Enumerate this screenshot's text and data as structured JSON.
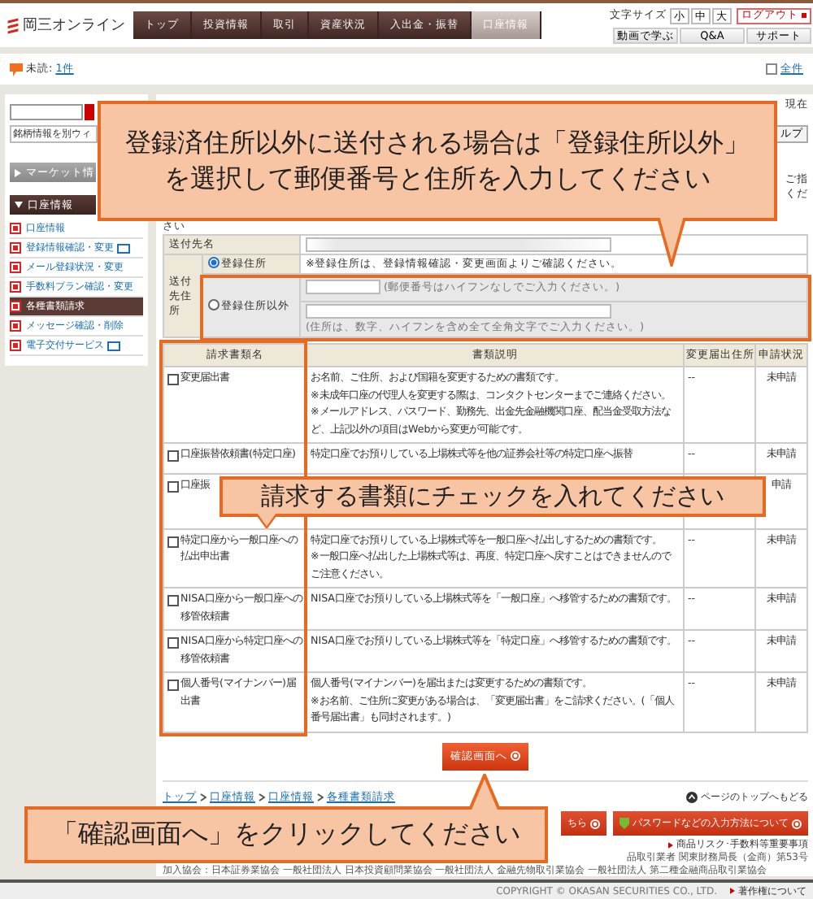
{
  "header": {
    "logo": "岡三オンライン",
    "nav": [
      {
        "label": "トップ",
        "selected": false
      },
      {
        "label": "投資情報",
        "selected": false
      },
      {
        "label": "取引",
        "selected": false
      },
      {
        "label": "資産状況",
        "selected": false
      },
      {
        "label": "入出金・振替",
        "selected": false
      },
      {
        "label": "口座情報",
        "selected": true
      }
    ],
    "font_size_label": "文字サイズ",
    "font_sizes": [
      "小",
      "中",
      "大"
    ],
    "logout": "ログアウト",
    "utility": [
      "動画で学ぶ",
      "Q&A",
      "サポート"
    ]
  },
  "notice": {
    "unread_label": "未読:",
    "unread_count": "1件",
    "all": "全件"
  },
  "sidebar": {
    "window_link": "銘柄情報を別ウィ",
    "market": "マーケット情",
    "section": "口座情報",
    "items": [
      {
        "label": "口座情報",
        "selected": false,
        "external": false
      },
      {
        "label": "登録情報確認・変更",
        "selected": false,
        "external": true
      },
      {
        "label": "メール登録状況・変更",
        "selected": false,
        "external": false
      },
      {
        "label": "手数料プラン確認・変更",
        "selected": false,
        "external": false
      },
      {
        "label": "各種書類請求",
        "selected": true,
        "external": false
      },
      {
        "label": "メッセージ確認・削除",
        "selected": false,
        "external": false
      },
      {
        "label": "電子交付サービス",
        "selected": false,
        "external": true
      }
    ]
  },
  "intro": {
    "now": "現在",
    "help": "ルプ",
    "right_fragments": [
      "ご指",
      "くだ"
    ],
    "left_fragment": "さい"
  },
  "form": {
    "name_label": "送付先名",
    "address_label": "送付先住所",
    "options": [
      {
        "kind": "registered",
        "label": "登録住所",
        "selected": true,
        "note": "※登録住所は、登録情報確認・変更画面よりご確認ください。"
      },
      {
        "kind": "other",
        "label": "登録住所以外",
        "selected": false,
        "postal_note": "(郵便番号はハイフンなしでご入力ください。)",
        "address_note": "(住所は、数字、ハイフンを含め全て全角文字でご入力ください。)"
      }
    ]
  },
  "documents": {
    "columns": [
      "請求書類名",
      "書類説明",
      "変更届出住所",
      "申請状況"
    ],
    "rows": [
      {
        "name": "変更届出書",
        "checked": false,
        "description": [
          "お名前、ご住所、および国籍を変更するための書類です。",
          "※未成年口座の代理人を変更する際は、コンタクトセンターまでご連絡ください。",
          "※メールアドレス、パスワード、勤務先、出金先金融機関口座、配当金受取方法など、上記以外の項目はWebから変更が可能です。"
        ],
        "address": "--",
        "status": "未申請"
      },
      {
        "name": "口座振替依頼書(特定口座)",
        "checked": false,
        "description": [
          "特定口座でお預りしている上場株式等を他の証券会社等の特定口座へ振替"
        ],
        "address": "--",
        "status": "未申請"
      },
      {
        "name": "口座振",
        "checked": false,
        "description": [],
        "address": "",
        "status": "申請"
      },
      {
        "name": "特定口座から一般口座への払出申出書",
        "checked": false,
        "description": [
          "特定口座でお預りしている上場株式等を一般口座へ払出しするための書類です。",
          "※一般口座へ払出した上場株式等は、再度、特定口座へ戻すことはできませんのでご注意ください。"
        ],
        "address": "--",
        "status": "未申請"
      },
      {
        "name": "NISA口座から一般口座への移管依頼書",
        "checked": false,
        "description": [
          "NISA口座でお預りしている上場株式等を「一般口座」へ移管するための書類です。"
        ],
        "address": "--",
        "status": "未申請"
      },
      {
        "name": "NISA口座から特定口座への移管依頼書",
        "checked": false,
        "description": [
          "NISA口座でお預りしている上場株式等を「特定口座」へ移管するための書類です。"
        ],
        "address": "--",
        "status": "未申請"
      },
      {
        "name": "個人番号(マイナンバー)届出書",
        "checked": false,
        "description": [
          "個人番号(マイナンバー)を届出または変更するための書類です。",
          "※お名前、ご住所に変更がある場合は、「変更届出書」をご請求ください。(「個人番号届出書」も同封されます。)"
        ],
        "address": "--",
        "status": "未申請"
      }
    ]
  },
  "confirm_button": "確認画面へ",
  "breadcrumb": [
    "トップ",
    "口座情報",
    "口座情報",
    "各種書類請求"
  ],
  "page_top": "ページのトップへもどる",
  "footer": {
    "buttons": [
      "ちら",
      "パスワードなどの入力方法について"
    ],
    "risk_link": "商品リスク･手数料等重要事項",
    "lines": [
      "品取引業者 関東財務局長（金商）第53号",
      "加入協会：日本証券業協会 一般社団法人 日本投資顧問業協会 一般社団法人 金融先物取引業協会 一般社団法人 第二種金融商品取引業協会"
    ],
    "copyright": "COPYRIGHT © OKASAN SECURITIES CO., LTD.",
    "copyright_link": "著作権について"
  },
  "callouts": [
    {
      "kind": "address",
      "text": "登録済住所以外に送付される場合は「登録住所以外」を選択して郵便番号と住所を入力してください"
    },
    {
      "kind": "check",
      "text": "請求する書類にチェックを入れてください"
    },
    {
      "kind": "confirm",
      "text": "「確認画面へ」をクリックしてください"
    }
  ]
}
